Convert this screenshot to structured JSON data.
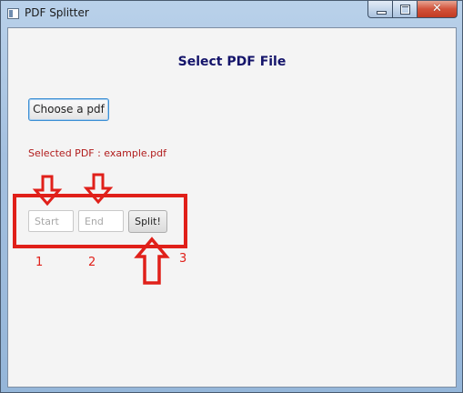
{
  "window": {
    "title": "PDF Splitter",
    "icon": "app-window-icon",
    "caption": {
      "minimize_icon": "minimize-icon",
      "maximize_icon": "maximize-icon",
      "close_glyph": "✕"
    }
  },
  "main": {
    "heading": "Select PDF File",
    "choose_button_label": "Choose a pdf",
    "selected_pdf_text": "Selected PDF : example.pdf",
    "start_placeholder": "Start",
    "end_placeholder": "End",
    "split_button_label": "Split!"
  },
  "annotations": {
    "step_labels": [
      "1",
      "2",
      "3"
    ],
    "color": "#e0201a"
  },
  "colors": {
    "heading": "#14146a",
    "selected_text": "#b11c1c",
    "focus_border": "#3c8fd4"
  }
}
